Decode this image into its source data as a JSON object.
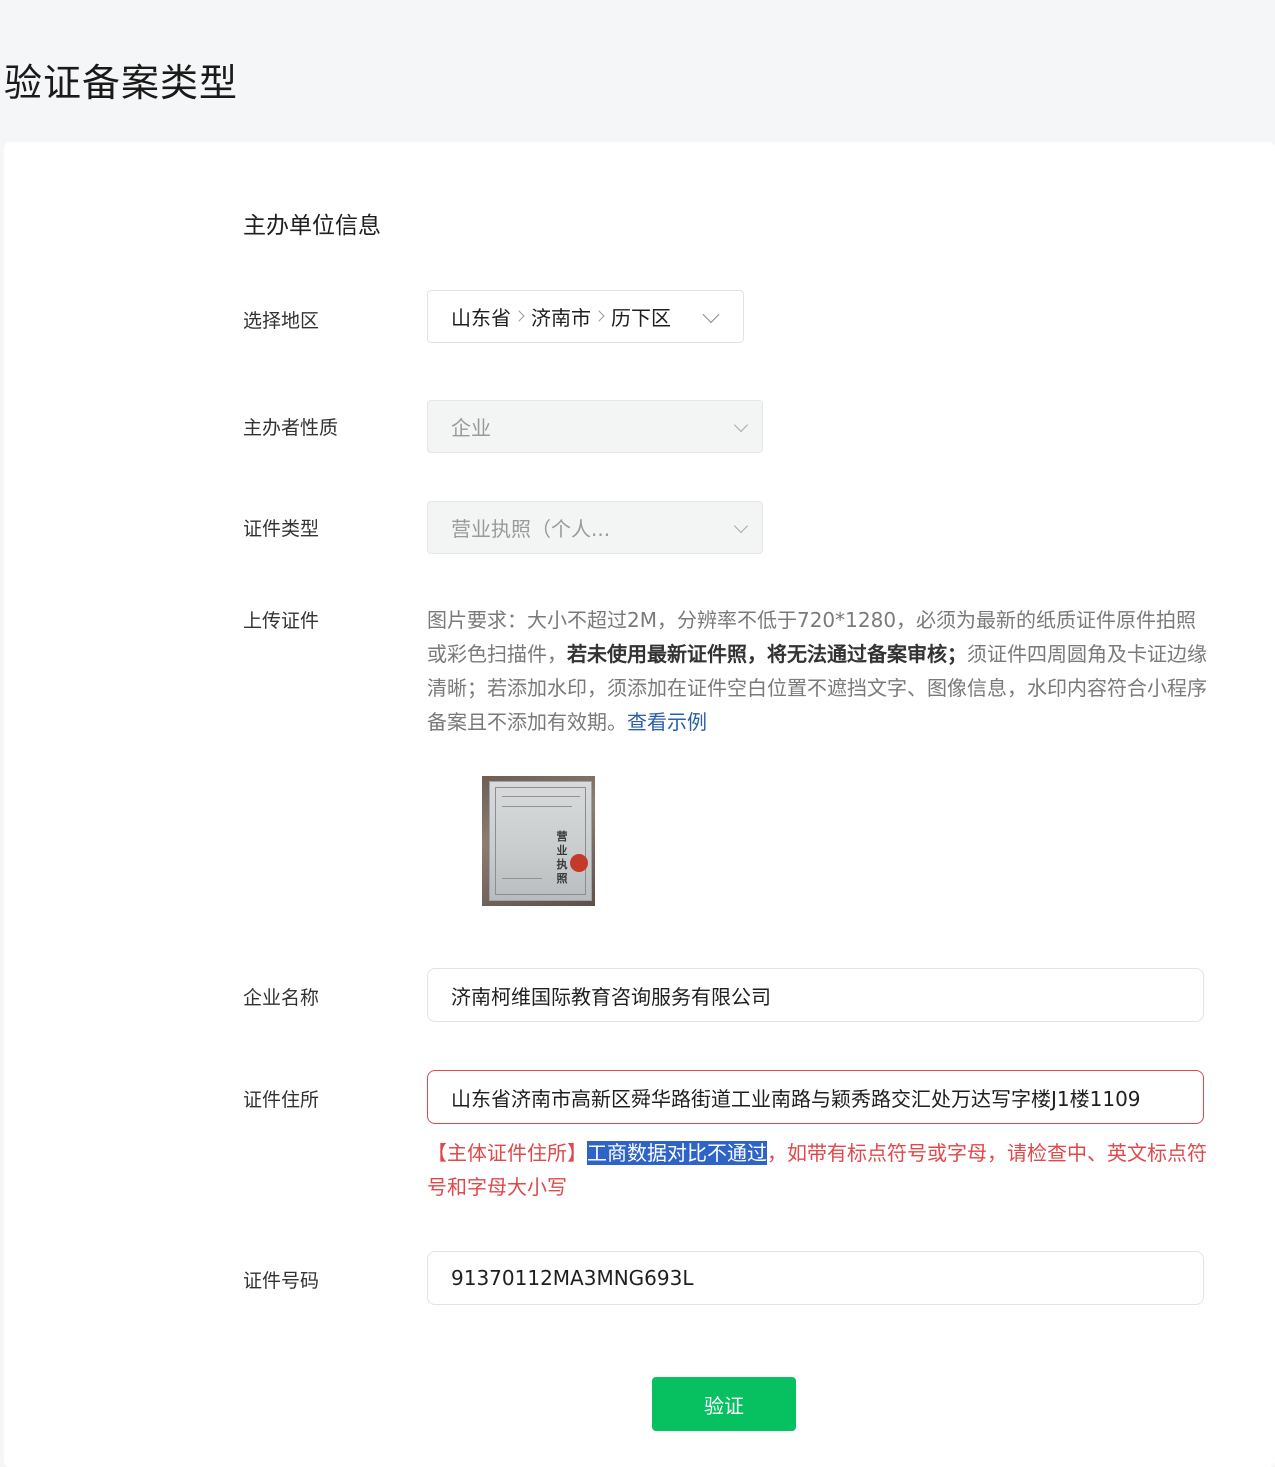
{
  "page_title": "验证备案类型",
  "section_title": "主办单位信息",
  "region": {
    "label": "选择地区",
    "province": "山东省",
    "city": "济南市",
    "district": "历下区"
  },
  "organizer_type": {
    "label": "主办者性质",
    "value": "企业"
  },
  "cert_type": {
    "label": "证件类型",
    "value": "营业执照（个人..."
  },
  "upload": {
    "label": "上传证件",
    "hint_1": "图片要求：大小不超过2M，分辨率不低于720*1280，必须为最新的纸质证件原件拍照或彩色扫描件，",
    "hint_bold": "若未使用最新证件照，将无法通过备案审核；",
    "hint_2": "须证件四周圆角及卡证边缘清晰；若添加水印，须添加在证件空白位置不遮挡文字、图像信息，水印内容符合小程序备案且不添加有效期。",
    "example_link": "查看示例",
    "thumbnail_text": "营业执照"
  },
  "company_name": {
    "label": "企业名称",
    "value": "济南柯维国际教育咨询服务有限公司"
  },
  "cert_address": {
    "label": "证件住所",
    "value": "山东省济南市高新区舜华路街道工业南路与颖秀路交汇处万达写字楼J1楼1109",
    "error_prefix": "【主体证件住所】",
    "error_selected": "工商数据对比不通过",
    "error_rest": "，如带有标点符号或字母，请检查中、英文标点符号和字母大小写"
  },
  "cert_number": {
    "label": "证件号码",
    "value": "91370112MA3MNG693L"
  },
  "submit_label": "验证",
  "colors": {
    "primary_green": "#07c160",
    "error_red": "#e0484a",
    "link_blue": "#2b5fa8",
    "selection_blue": "#2e63c7"
  }
}
